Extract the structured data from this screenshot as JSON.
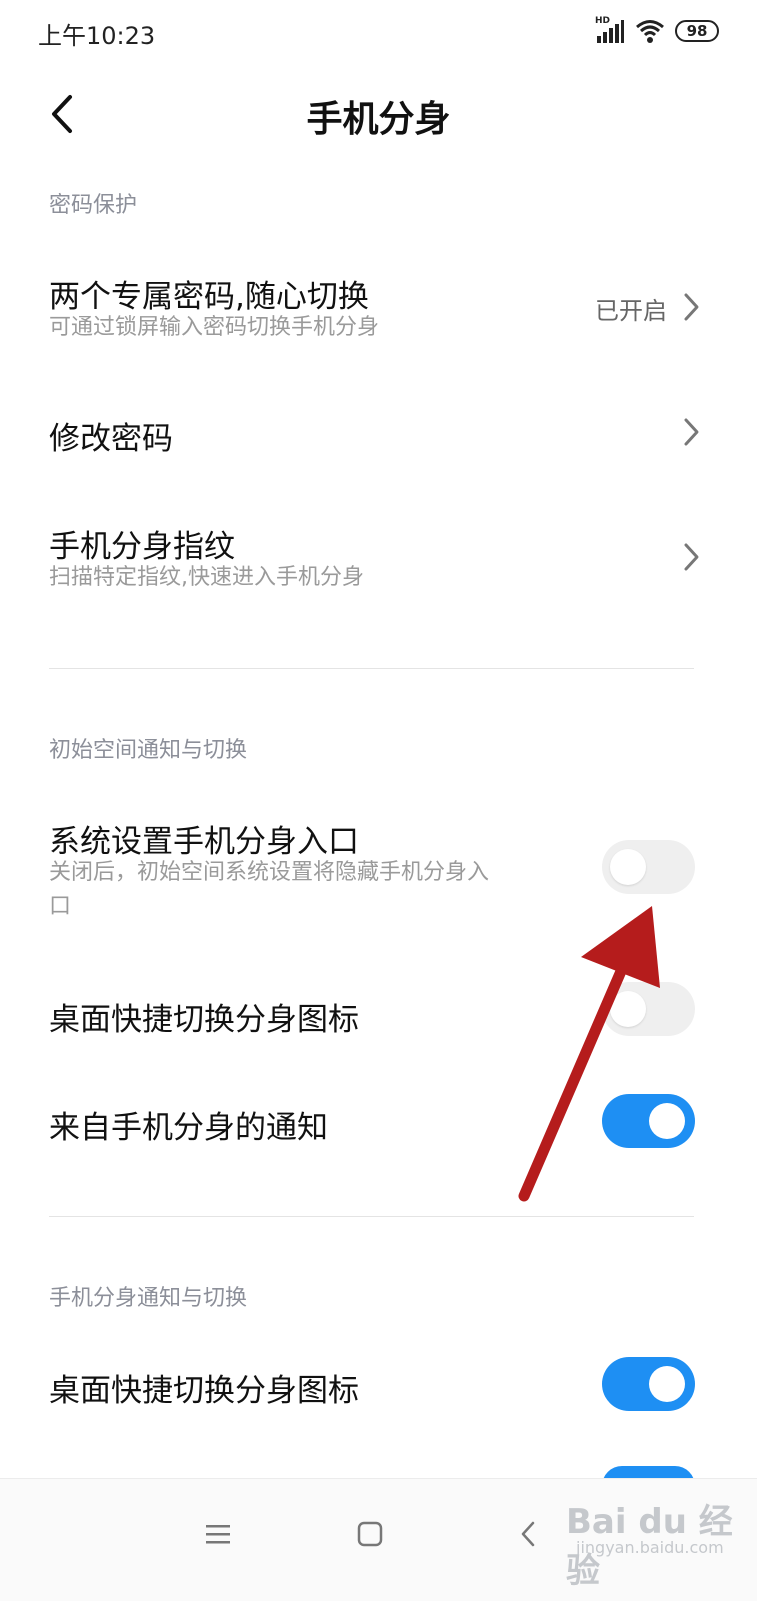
{
  "status": {
    "time": "上午10:23",
    "battery": "98",
    "network_label": "HD"
  },
  "header": {
    "title": "手机分身"
  },
  "sections": [
    {
      "title": "密码保护",
      "items": [
        {
          "title": "两个专属密码,随心切换",
          "subtitle": "可通过锁屏输入密码切换手机分身",
          "value": "已开启"
        },
        {
          "title": "修改密码"
        },
        {
          "title": "手机分身指纹",
          "subtitle": "扫描特定指纹,快速进入手机分身"
        }
      ]
    },
    {
      "title": "初始空间通知与切换",
      "items": [
        {
          "title": "系统设置手机分身入口",
          "subtitle_line1": "关闭后，初始空间系统设置将隐藏手机分身入",
          "subtitle_line2": "口",
          "toggle": "off"
        },
        {
          "title": "桌面快捷切换分身图标",
          "toggle": "off"
        },
        {
          "title": "来自手机分身的通知",
          "toggle": "on"
        }
      ]
    },
    {
      "title": "手机分身通知与切换",
      "items": [
        {
          "title": "桌面快捷切换分身图标",
          "toggle": "on"
        }
      ]
    }
  ],
  "colors": {
    "accent": "#1e8ff3",
    "arrow": "#b51c1c",
    "toggle_off": "#efefef"
  },
  "watermark": {
    "text": "Bai du 经验",
    "sub": "jingyan.baidu.com"
  },
  "icons": [
    "back-arrow-icon",
    "chevron-right-icon",
    "signal-icon",
    "wifi-icon",
    "battery-icon",
    "menu-icon",
    "home-icon",
    "nav-back-icon"
  ]
}
